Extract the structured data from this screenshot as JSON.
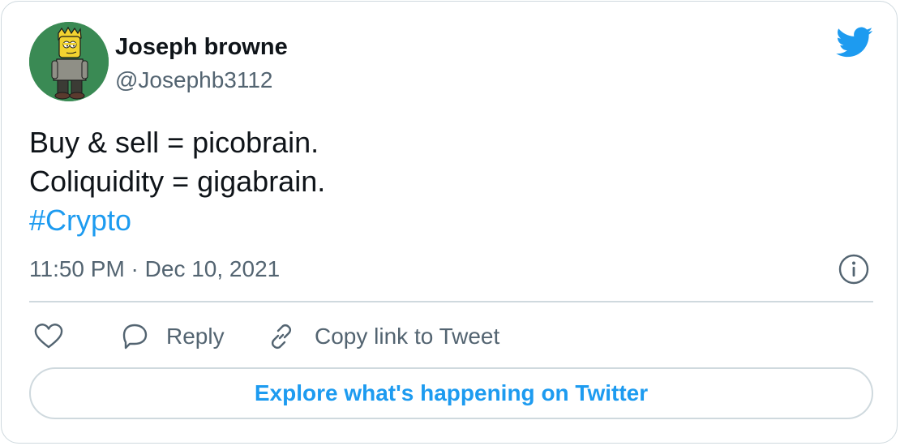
{
  "author": {
    "display_name": "Joseph browne",
    "handle": "@Josephb3112",
    "avatar_icon": "cartoon-character-avatar"
  },
  "brand_icon": "twitter-bird-icon",
  "tweet": {
    "lines": [
      "Buy & sell = picobrain.",
      "Coliquidity = gigabrain."
    ],
    "hashtag": "#Crypto",
    "timestamp": "11:50 PM · Dec 10, 2021"
  },
  "actions": {
    "like_icon": "heart-icon",
    "reply_label": "Reply",
    "copy_link_label": "Copy link to Tweet"
  },
  "explore_label": "Explore what's happening on Twitter",
  "colors": {
    "accent": "#1d9bf0",
    "text": "#0f1419",
    "secondary_text": "#536471",
    "border": "#cfd9de",
    "avatar_bg": "#3a8a54"
  }
}
